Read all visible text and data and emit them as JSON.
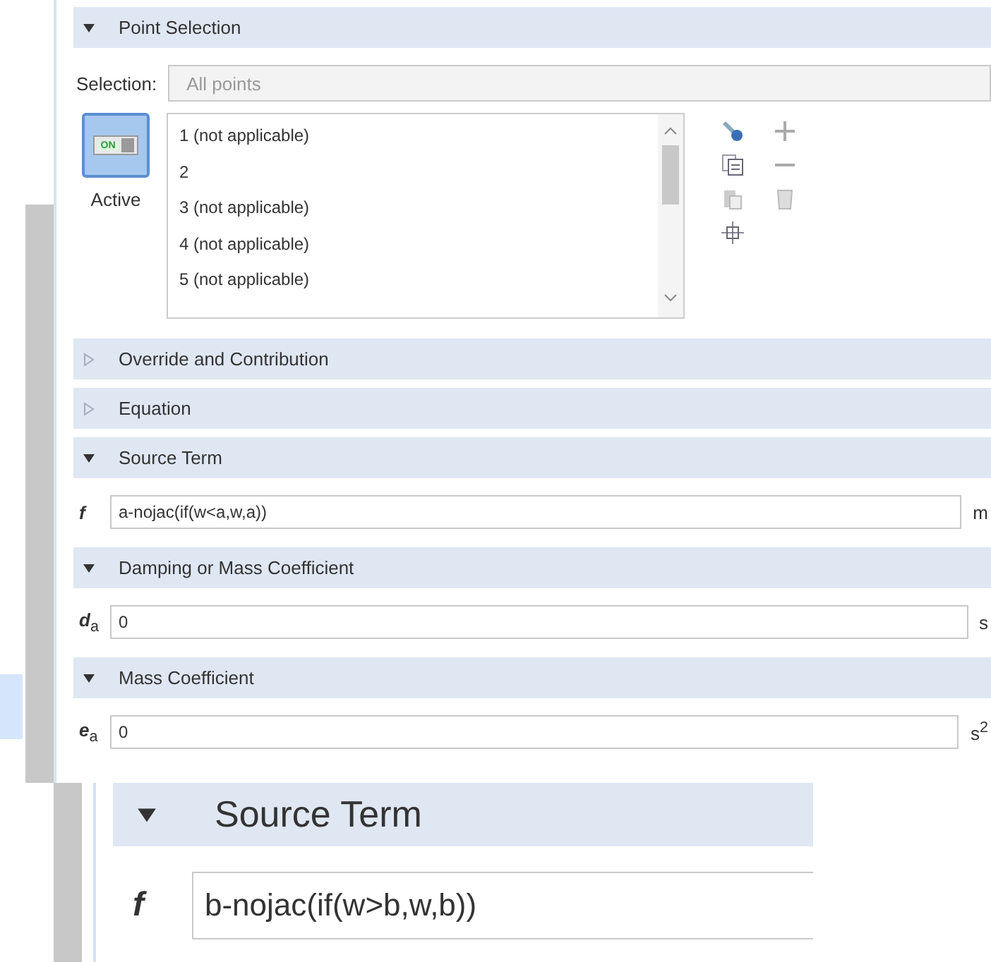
{
  "point_selection": {
    "title": "Point Selection",
    "expanded": true,
    "selection_label": "Selection:",
    "selection_value": "All points",
    "toggle_text": "ON",
    "active": true,
    "active_label": "Active",
    "points": [
      "1 (not applicable)",
      "2",
      "3 (not applicable)",
      "4 (not applicable)",
      "5 (not applicable)"
    ]
  },
  "sections": [
    {
      "kind": "header",
      "title": "Override and Contribution",
      "expanded": false
    },
    {
      "kind": "header",
      "title": "Equation",
      "expanded": false
    },
    {
      "kind": "field",
      "title": "Source Term",
      "expanded": true,
      "symbol": "f",
      "value": "a-nojac(if(w<a,w,a))",
      "unit": "m"
    },
    {
      "kind": "field",
      "title": "Damping or Mass Coefficient",
      "expanded": true,
      "symbol": "d$_{a}$",
      "value": "0",
      "unit": "s"
    },
    {
      "kind": "field",
      "title": "Mass Coefficient",
      "expanded": true,
      "symbol": "e$_{a}$",
      "value": "0",
      "unit": "s$^{2}$"
    }
  ],
  "inset": {
    "title": "Source Term",
    "expanded": true,
    "symbol": "f",
    "value": "b-nojac(if(w>b,w,b))"
  }
}
